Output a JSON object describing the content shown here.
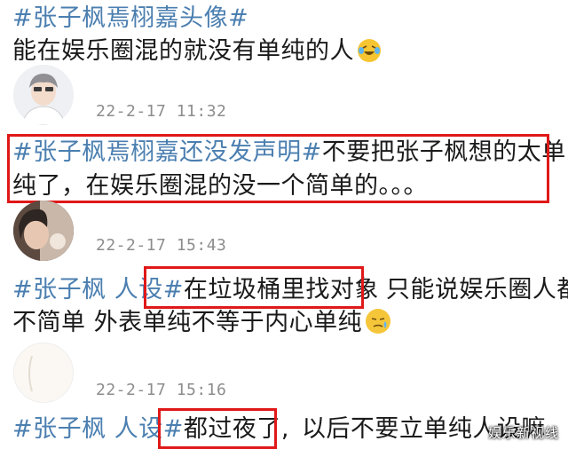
{
  "comments": [
    {
      "line1_tag": "#张子枫焉栩嘉头像#",
      "line2_text": "能在娱乐圈混的就没有单纯的人",
      "emoji": "laughing-crying-emoji",
      "time": "22-2-17 11:32"
    },
    {
      "line1_tag": "#张子枫焉栩嘉还没发声明#",
      "line1_text": "不要把张子枫想的太单",
      "line2_text": "纯了，在娱乐圈混的没一个简单的。。。",
      "time": "22-2-17 15:43"
    },
    {
      "line1_tag": "#张子枫 人设#",
      "line1_highlight": "在垃圾桶里找对象",
      "line1_text": "只能说娱乐圈人都",
      "line2_text": "不简单 外表单纯不等于内心单纯",
      "emoji": "sweating-emoji",
      "time": "22-2-17 15:16"
    },
    {
      "line1_tag": "#张子枫 人设#",
      "line1_highlight": "都过夜了,",
      "line1_text": "以后不要立单纯人设嘛"
    }
  ],
  "watermark": "娱乐新视线",
  "colors": {
    "hashtag": "#4b7fb0",
    "highlight_box": "#e01818",
    "timestamp": "#8d8d8d"
  }
}
